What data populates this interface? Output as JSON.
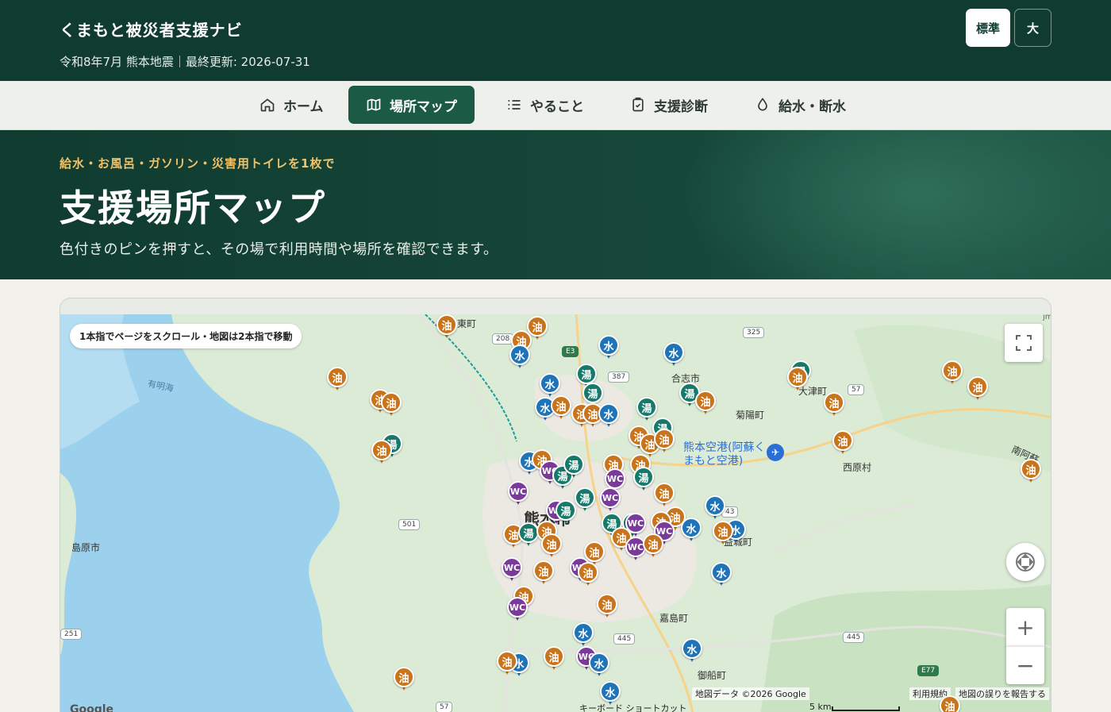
{
  "header": {
    "title": "くまもと被災者支援ナビ",
    "subtitle": "令和8年7月 熊本地震｜最終更新: 2026-07-31",
    "font_size_standard": "標準",
    "font_size_large": "大"
  },
  "nav": {
    "items": [
      {
        "label": "ホーム",
        "icon": "home-icon"
      },
      {
        "label": "場所マップ",
        "icon": "map-icon"
      },
      {
        "label": "やること",
        "icon": "checklist-icon"
      },
      {
        "label": "支援診断",
        "icon": "clipboard-check-icon"
      },
      {
        "label": "給水・断水",
        "icon": "water-drop-icon"
      }
    ],
    "active_index": 1
  },
  "hero": {
    "kicker": "給水・お風呂・ガソリン・災害用トイレを1枚で",
    "title": "支援場所マップ",
    "lead": "色付きのピンを押すと、その場で利用時間や場所を確認できます。"
  },
  "map": {
    "hint": "1本指でページをスクロール・地図は2本指で移動",
    "pin_labels": {
      "water": "水",
      "bath": "湯",
      "fuel": "油",
      "toilet": "WC"
    },
    "pin_colors": {
      "water": "#1f73b7",
      "bath": "#167a6a",
      "fuel": "#c9731a",
      "toilet": "#7a3a9a"
    },
    "place_labels": {
      "higashi": "東町",
      "koshi": "合志市",
      "kikuyo": "菊陽町",
      "ozu": "大津町",
      "nishihara": "西原村",
      "shimabara": "島原市",
      "kashima": "嘉島町",
      "mifune": "御船町",
      "airport": "熊本空港(阿蘇くまもと空港)",
      "sea": "有明海",
      "city": "熊本市",
      "minamiaso": "南阿蘇",
      "mashiki": "益城町"
    },
    "road_numbers": [
      "208",
      "E3",
      "387",
      "325",
      "57",
      "501",
      "251",
      "445",
      "445",
      "E77",
      "57",
      "43"
    ],
    "attribution": {
      "data": "地図データ ©2026 Google",
      "terms": "利用規約",
      "report": "地図の誤りを報告する",
      "scale": "5 km",
      "keyboard": "キーボード ショートカット",
      "google": "Google",
      "corner_mark": "jm"
    }
  }
}
